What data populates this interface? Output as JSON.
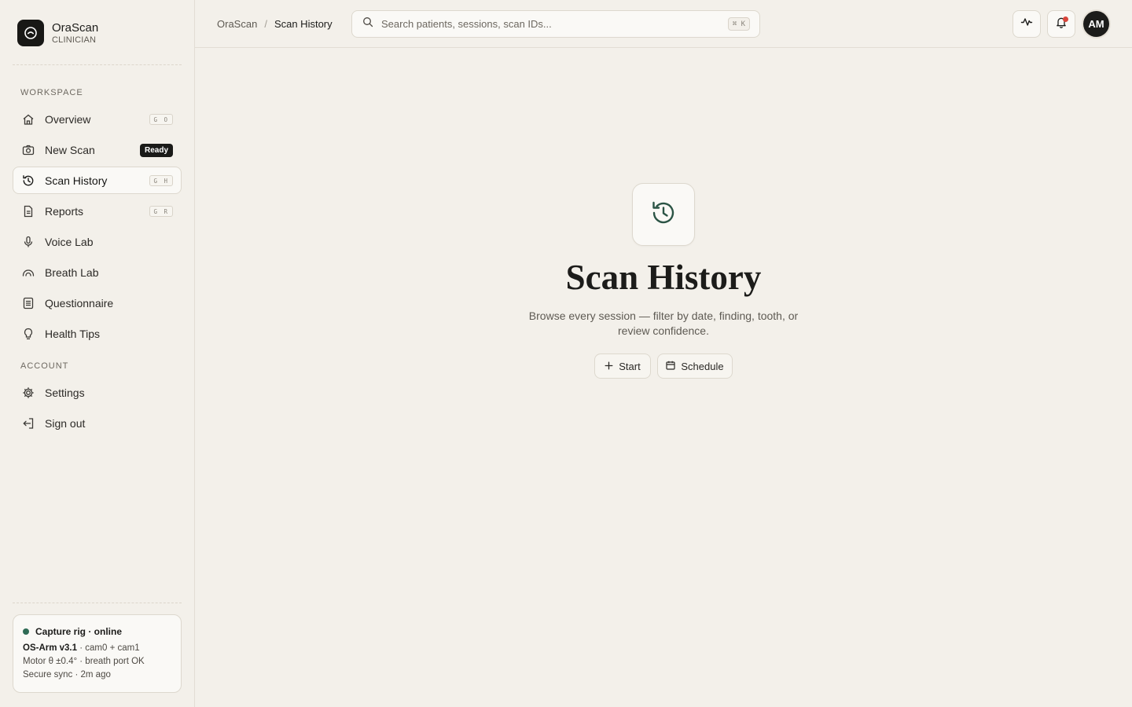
{
  "app": {
    "name": "OraScan",
    "role": "CLINICIAN"
  },
  "sidebar": {
    "workspace_label": "WORKSPACE",
    "account_label": "ACCOUNT",
    "items": [
      {
        "label": "Overview",
        "icon": "home-icon",
        "shortcut": "G O"
      },
      {
        "label": "New Scan",
        "icon": "camera-icon",
        "badge": "Ready"
      },
      {
        "label": "Scan History",
        "icon": "history-icon",
        "shortcut": "G H",
        "active": true
      },
      {
        "label": "Reports",
        "icon": "document-icon",
        "shortcut": "G R"
      },
      {
        "label": "Voice Lab",
        "icon": "microphone-icon"
      },
      {
        "label": "Breath Lab",
        "icon": "breath-icon"
      },
      {
        "label": "Questionnaire",
        "icon": "list-icon"
      },
      {
        "label": "Health Tips",
        "icon": "lightbulb-icon"
      }
    ],
    "account_items": [
      {
        "label": "Settings",
        "icon": "gear-icon"
      },
      {
        "label": "Sign out",
        "icon": "sign-out-icon"
      }
    ],
    "rig": {
      "status": "Capture rig · online",
      "model": "OS-Arm v3.1",
      "cams": " · cam0 + cam1",
      "motor": "Motor θ ±0.4° · breath port OK",
      "sync": "Secure sync · 2m ago",
      "status_color": "#2f6b55"
    }
  },
  "header": {
    "breadcrumb_root": "OraScan",
    "breadcrumb_sep": "/",
    "breadcrumb_current": "Scan History",
    "search_placeholder": "Search patients, sessions, scan IDs...",
    "search_shortcut": "⌘ K",
    "avatar_initials": "AM",
    "notification_color": "#d8453b"
  },
  "main": {
    "title": "Scan History",
    "description": "Browse every session — filter by date, finding, tooth, or review confidence.",
    "start_label": "Start",
    "schedule_label": "Schedule",
    "icon": "history-icon"
  }
}
